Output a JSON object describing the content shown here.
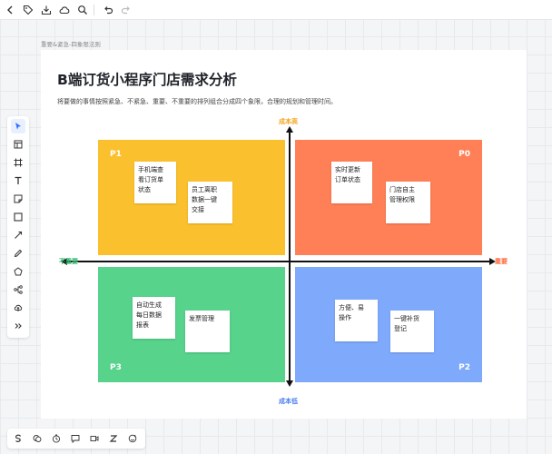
{
  "toolbar": {
    "icons": [
      "back-icon",
      "tag-icon",
      "export-icon",
      "cloud-icon",
      "search-icon",
      "undo-icon",
      "redo-icon"
    ]
  },
  "breadcrumb": "重要&紧急-四象限法则",
  "board": {
    "title": "B端订货小程序门店需求分析",
    "subtitle": "将要做的事情按照紧急、不紧急、重要、不重要的排列组合分成四个象限，合理的规划和管理时间。",
    "axes": {
      "top": "成本高",
      "bottom": "成本低",
      "left": "不重要",
      "right": "重要"
    },
    "quadrants": {
      "top_left": {
        "label": "P1",
        "color": "#fbc02d",
        "notes": [
          "手机端查\n看订货单\n状态",
          "员工离职\n数据一键\n交接"
        ]
      },
      "top_right": {
        "label": "P0",
        "color": "#ff8057",
        "notes": [
          "实时更新\n订单状态",
          "门店自主\n管理权限"
        ]
      },
      "bottom_left": {
        "label": "P3",
        "color": "#57d38c",
        "notes": [
          "自动生成\n每日数据\n报表",
          "发票管理"
        ]
      },
      "bottom_right": {
        "label": "P2",
        "color": "#7fa9fb",
        "notes": [
          "方便、易\n操作",
          "一键补货\n登记"
        ]
      }
    }
  },
  "left_toolbar": {
    "icons": [
      "select-icon",
      "template-icon",
      "frame-icon",
      "text-icon",
      "sticky-note-icon",
      "shape-icon",
      "line-icon",
      "pen-icon",
      "polygon-icon",
      "mindmap-icon",
      "upload-icon",
      "more-icon"
    ]
  },
  "bottom_toolbar": {
    "icons": [
      "s-icon",
      "comment-icon",
      "timer-icon",
      "chat-icon",
      "video-icon",
      "z-icon",
      "emoji-icon"
    ]
  }
}
